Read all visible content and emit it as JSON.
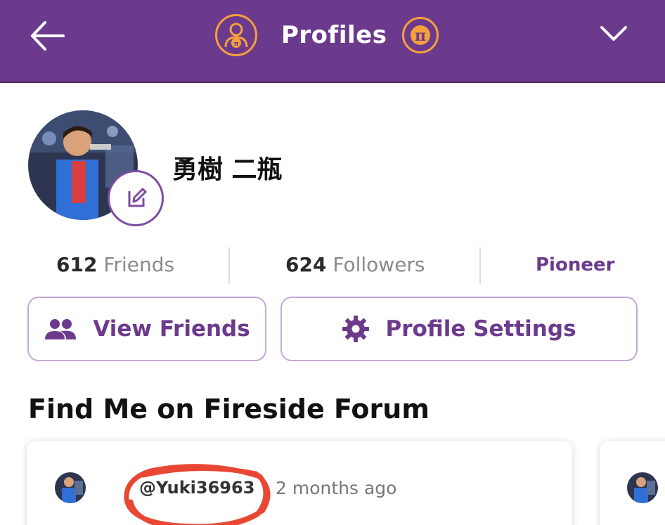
{
  "header": {
    "title": "Profiles",
    "back_icon": "arrow-left-icon",
    "menu_icon": "chevron-down-icon",
    "left_logo_icon": "pi-profile-icon",
    "right_logo_icon": "pi-coin-icon",
    "bg_color": "#6c3a8d",
    "accent_color": "#f6a03b"
  },
  "profile": {
    "name": "勇樹 二瓶",
    "edit_icon": "pencil-edit-icon"
  },
  "stats": {
    "friends_count": "612",
    "friends_label": "Friends",
    "followers_count": "624",
    "followers_label": "Followers",
    "role": "Pioneer"
  },
  "actions": {
    "view_friends": "View Friends",
    "view_friends_icon": "people-icon",
    "profile_settings": "Profile Settings",
    "profile_settings_icon": "gear-icon"
  },
  "forum": {
    "section_title": "Find Me on Fireside Forum",
    "posts": [
      {
        "handle": "@Yuki36963",
        "time": "2 months ago"
      }
    ]
  }
}
